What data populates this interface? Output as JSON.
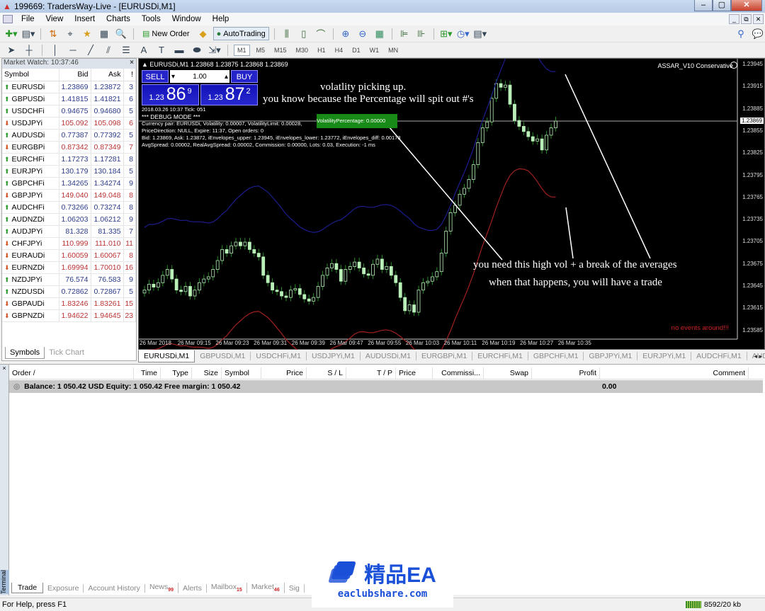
{
  "window": {
    "title": "199669: TradersWay-Live - [EURUSDi,M1]",
    "min": "–",
    "max": "▢",
    "close": "✕"
  },
  "menu": [
    "File",
    "View",
    "Insert",
    "Charts",
    "Tools",
    "Window",
    "Help"
  ],
  "mdi": {
    "min": "_",
    "restore": "⧉",
    "close": "✕"
  },
  "toolbar": {
    "new_order": "New Order",
    "autotrading": "AutoTrading",
    "timeframes": [
      "M1",
      "M5",
      "M15",
      "M30",
      "H1",
      "H4",
      "D1",
      "W1",
      "MN"
    ],
    "active_tf": "M1"
  },
  "market_watch": {
    "title": "Market Watch: 10:37:46",
    "close": "×",
    "columns": [
      "Symbol",
      "Bid",
      "Ask",
      "!"
    ],
    "rows": [
      {
        "symbol": "EURUSDi",
        "bid": "1.23869",
        "ask": "1.23872",
        "spread": "3",
        "dir": "up"
      },
      {
        "symbol": "GBPUSDi",
        "bid": "1.41815",
        "ask": "1.41821",
        "spread": "6",
        "dir": "up"
      },
      {
        "symbol": "USDCHFi",
        "bid": "0.94675",
        "ask": "0.94680",
        "spread": "5",
        "dir": "up"
      },
      {
        "symbol": "USDJPYi",
        "bid": "105.092",
        "ask": "105.098",
        "spread": "6",
        "dir": "dn"
      },
      {
        "symbol": "AUDUSDi",
        "bid": "0.77387",
        "ask": "0.77392",
        "spread": "5",
        "dir": "up"
      },
      {
        "symbol": "EURGBPi",
        "bid": "0.87342",
        "ask": "0.87349",
        "spread": "7",
        "dir": "dn"
      },
      {
        "symbol": "EURCHFi",
        "bid": "1.17273",
        "ask": "1.17281",
        "spread": "8",
        "dir": "up"
      },
      {
        "symbol": "EURJPYi",
        "bid": "130.179",
        "ask": "130.184",
        "spread": "5",
        "dir": "up"
      },
      {
        "symbol": "GBPCHFi",
        "bid": "1.34265",
        "ask": "1.34274",
        "spread": "9",
        "dir": "up"
      },
      {
        "symbol": "GBPJPYi",
        "bid": "149.040",
        "ask": "149.048",
        "spread": "8",
        "dir": "dn"
      },
      {
        "symbol": "AUDCHFi",
        "bid": "0.73266",
        "ask": "0.73274",
        "spread": "8",
        "dir": "up"
      },
      {
        "symbol": "AUDNZDi",
        "bid": "1.06203",
        "ask": "1.06212",
        "spread": "9",
        "dir": "up"
      },
      {
        "symbol": "AUDJPYi",
        "bid": "81.328",
        "ask": "81.335",
        "spread": "7",
        "dir": "up"
      },
      {
        "symbol": "CHFJPYi",
        "bid": "110.999",
        "ask": "111.010",
        "spread": "11",
        "dir": "dn"
      },
      {
        "symbol": "EURAUDi",
        "bid": "1.60059",
        "ask": "1.60067",
        "spread": "8",
        "dir": "dn"
      },
      {
        "symbol": "EURNZDi",
        "bid": "1.69994",
        "ask": "1.70010",
        "spread": "16",
        "dir": "dn"
      },
      {
        "symbol": "NZDJPYi",
        "bid": "76.574",
        "ask": "76.583",
        "spread": "9",
        "dir": "up"
      },
      {
        "symbol": "NZDUSDi",
        "bid": "0.72862",
        "ask": "0.72867",
        "spread": "5",
        "dir": "up"
      },
      {
        "symbol": "GBPAUDi",
        "bid": "1.83246",
        "ask": "1.83261",
        "spread": "15",
        "dir": "dn"
      },
      {
        "symbol": "GBPNZDi",
        "bid": "1.94622",
        "ask": "1.94645",
        "spread": "23",
        "dir": "dn"
      }
    ],
    "tabs": [
      "Symbols",
      "Tick Chart"
    ]
  },
  "chart": {
    "header": "EURUSDi,M1  1.23868 1.23875 1.23868 1.23869",
    "one_click": {
      "sell": "SELL",
      "buy": "BUY",
      "lot": "1.00",
      "sell_small": "1.23",
      "sell_big": "86",
      "sell_sup": "9",
      "buy_small": "1.23",
      "buy_big": "87",
      "buy_sup": "2"
    },
    "debug_lines": [
      "2018.03.26 10:37 Tick: 051",
      "*** DEBUG MODE ***",
      "Currency pair: EURUSDi, Volatility: 0.00007, VolatilityLimit: 0.00028,",
      "PriceDirection: NULL, Expire: 11:37, Open orders: 0",
      "Bid: 1.23869, Ask: 1.23872, iEnvelopes_upper: 1.23945, iEnvelopes_lower: 1.23772, iEnvelopes_diff: 0.00173",
      "AvgSpread: 0.00002, RealAvgSpread: 0.00002, Commission: 0.00000, Lots: 0.03, Execution: -1 ms"
    ],
    "volatility_percentage": "VolatilityPercentage: 0.00000",
    "annotations": {
      "a1": "volatlity picking up.",
      "a2": "you know because the Percentage will spit out #'s",
      "a3": "you need this high vol + a break of the averages",
      "a4": "when that happens, you will have a trade"
    },
    "ea_name": "ASSAR_V10 Conservative",
    "no_events": "no events around!!!",
    "y_ticks": [
      "1.23945",
      "1.23915",
      "1.23885",
      "1.23855",
      "1.23825",
      "1.23795",
      "1.23765",
      "1.23735",
      "1.23705",
      "1.23675",
      "1.23645",
      "1.23615",
      "1.23585"
    ],
    "current_price": "1.23869",
    "x_ticks": [
      "26 Mar 2018",
      "26 Mar 09:15",
      "26 Mar 09:23",
      "26 Mar 09:31",
      "26 Mar 09:39",
      "26 Mar 09:47",
      "26 Mar 09:55",
      "26 Mar 10:03",
      "26 Mar 10:11",
      "26 Mar 10:19",
      "26 Mar 10:27",
      "26 Mar 10:35"
    ],
    "colors": {
      "bull": "#b8f0b8",
      "bear": "#2a8a2a",
      "upper": "#1c1c8c",
      "lower": "#a02020"
    }
  },
  "chart_tabs": [
    "EURUSDi,M1",
    "GBPUSDi,M1",
    "USDCHFi,M1",
    "USDJPYi,M1",
    "AUDUSDi,M1",
    "EURGBPi,M1",
    "EURCHFi,M1",
    "GBPCHFi,M1",
    "GBPJPYi,M1",
    "EURJPYi,M1",
    "AUDCHFi,M1",
    "AUDI"
  ],
  "terminal": {
    "label": "Terminal",
    "columns": [
      "Order  /",
      "Time",
      "Type",
      "Size",
      "Symbol",
      "Price",
      "S / L",
      "T / P",
      "Price",
      "Commissi...",
      "Swap",
      "Profit",
      "Comment"
    ],
    "balance": "Balance: 1 050.42 USD  Equity: 1 050.42  Free margin: 1 050.42",
    "profit": "0.00",
    "tabs": [
      {
        "label": "Trade",
        "badge": ""
      },
      {
        "label": "Exposure",
        "badge": ""
      },
      {
        "label": "Account History",
        "badge": ""
      },
      {
        "label": "News",
        "badge": "99"
      },
      {
        "label": "Alerts",
        "badge": ""
      },
      {
        "label": "Mailbox",
        "badge": "15"
      },
      {
        "label": "Market",
        "badge": "46"
      },
      {
        "label": "Sig",
        "badge": ""
      }
    ]
  },
  "status": {
    "help": "For Help, press F1",
    "traffic": "8592/20 kb"
  },
  "watermark": {
    "title": "精品EA",
    "url": "eaclubshare.com"
  }
}
